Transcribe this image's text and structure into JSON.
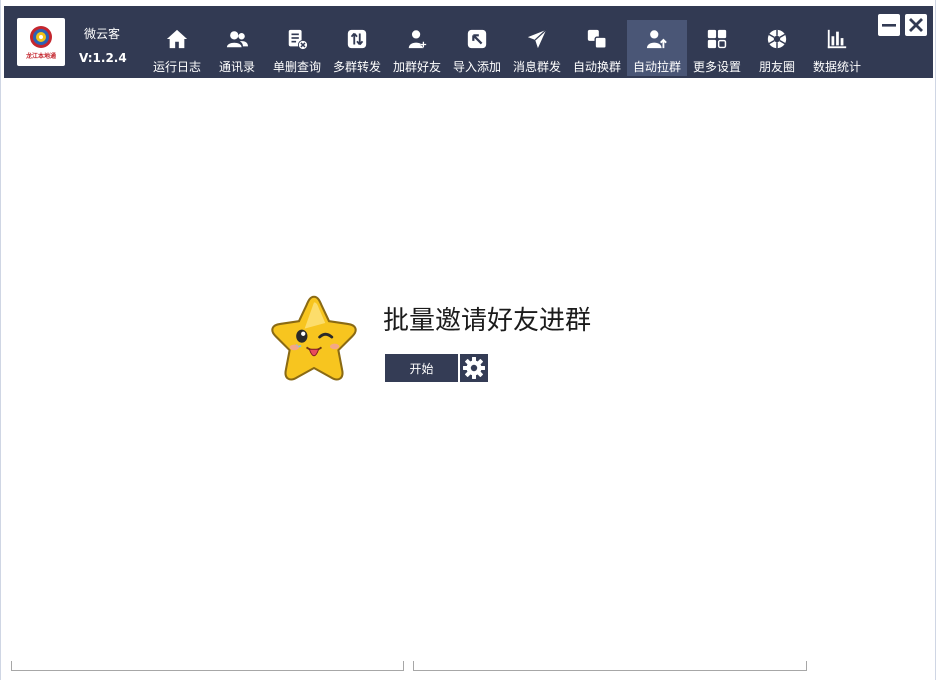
{
  "app": {
    "name": "微云客",
    "version": "V:1.2.4",
    "logo_text": "龙江本地通"
  },
  "nav": [
    {
      "label": "运行日志",
      "icon": "home-icon"
    },
    {
      "label": "通讯录",
      "icon": "contacts-icon"
    },
    {
      "label": "单删查询",
      "icon": "delete-check-icon"
    },
    {
      "label": "多群转发",
      "icon": "forward-icon"
    },
    {
      "label": "加群好友",
      "icon": "add-friend-icon"
    },
    {
      "label": "导入添加",
      "icon": "import-icon"
    },
    {
      "label": "消息群发",
      "icon": "send-icon"
    },
    {
      "label": "自动换群",
      "icon": "switch-group-icon"
    },
    {
      "label": "自动拉群",
      "icon": "pull-group-icon",
      "active": true
    },
    {
      "label": "更多设置",
      "icon": "grid-icon"
    },
    {
      "label": "朋友圈",
      "icon": "aperture-icon"
    },
    {
      "label": "数据统计",
      "icon": "bar-chart-icon"
    }
  ],
  "main": {
    "headline": "批量邀请好友进群",
    "start_label": "开始",
    "mascot": "star-mascot-icon"
  },
  "colors": {
    "header_bg": "#323a53",
    "active_nav_bg": "#4a5676",
    "button_bg": "#343c55",
    "star_yellow": "#f7c51f"
  }
}
